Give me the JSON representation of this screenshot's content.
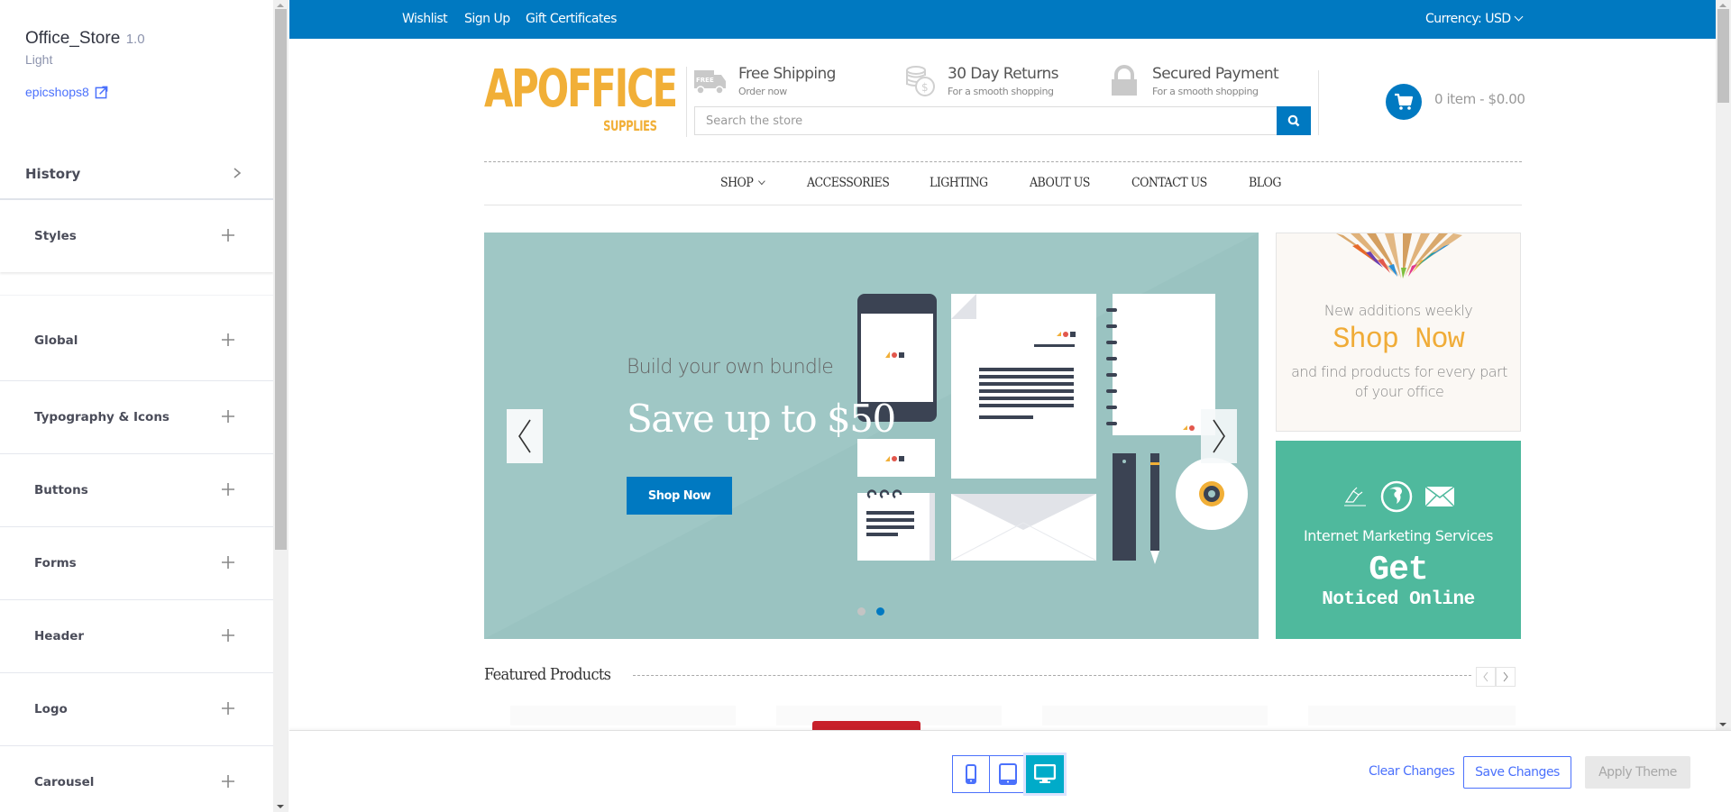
{
  "sidebar": {
    "theme_name": "Office_Store",
    "theme_version": "1.0",
    "theme_variant": "Light",
    "store_link": "epicshops8",
    "history_label": "History",
    "styles_label": "Styles",
    "sections": [
      {
        "label": "Global"
      },
      {
        "label": "Typography & Icons"
      },
      {
        "label": "Buttons"
      },
      {
        "label": "Forms"
      },
      {
        "label": "Header"
      },
      {
        "label": "Logo"
      },
      {
        "label": "Carousel"
      }
    ]
  },
  "store": {
    "topbar": {
      "links": [
        "Wishlist",
        "Sign Up",
        "Gift Certificates"
      ],
      "currency": "Currency: USD"
    },
    "logo": {
      "main": "APOFFICE",
      "sub": "SUPPLIES"
    },
    "info_blocks": [
      {
        "icon": "truck-icon",
        "title": "Free Shipping",
        "subtitle": "Order now",
        "badge": "FREE"
      },
      {
        "icon": "coins-icon",
        "title": "30 Day Returns",
        "subtitle": "For a smooth shopping"
      },
      {
        "icon": "lock-icon",
        "title": "Secured Payment",
        "subtitle": "For a smooth shopping"
      }
    ],
    "search": {
      "placeholder": "Search the store",
      "value": ""
    },
    "cart": {
      "text": "0 item - $0.00"
    },
    "nav": [
      "SHOP",
      "ACCESSORIES",
      "LIGHTING",
      "ABOUT US",
      "CONTACT US",
      "BLOG"
    ],
    "slider": {
      "subtitle": "Build your own bundle",
      "title": "Save up to $50",
      "button": "Shop Now",
      "slide_count": 2,
      "active_slide": 2
    },
    "promo_top": {
      "line1": "New additions weekly",
      "headline": "Shop Now",
      "line2": "and find products for every part of your office"
    },
    "promo_bottom": {
      "line1": "Internet Marketing Services",
      "headline": "Get",
      "line2": "Noticed Online"
    },
    "featured_title": "Featured Products"
  },
  "bottombar": {
    "devices": [
      {
        "name": "mobile",
        "active": false
      },
      {
        "name": "tablet",
        "active": false
      },
      {
        "name": "desktop",
        "active": true
      }
    ],
    "clear_label": "Clear Changes",
    "save_label": "Save Changes",
    "apply_label": "Apply Theme"
  },
  "colors": {
    "brand_blue": "#0079c1",
    "accent_link": "#4b71fc",
    "logo_gold": "#f1af37",
    "slider_bg": "#9fc7c5",
    "promo_green": "#4fb99d",
    "device_active": "#00abc9"
  }
}
